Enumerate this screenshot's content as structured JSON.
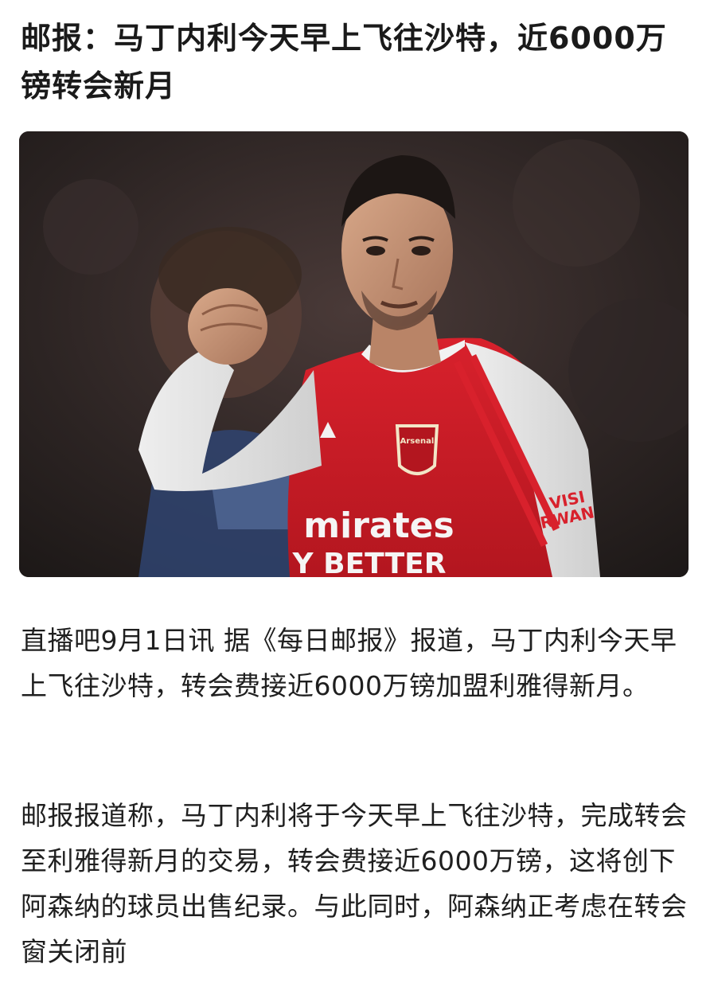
{
  "article": {
    "headline": "邮报：马丁内利今天早上飞往沙特，近6000万镑转会新月",
    "image": {
      "sponsor_line_1": "mirates",
      "sponsor_line_2": "Y BETTER",
      "sleeve_text_1": "VISI",
      "sleeve_text_2": "RWAN",
      "crest_text": "Arsenal"
    },
    "paragraphs": [
      "直播吧9月1日讯 据《每日邮报》报道，马丁内利今天早上飞往沙特，转会费接近6000万镑加盟利雅得新月。",
      "邮报报道称，马丁内利将于今天早上飞往沙特，完成转会至利雅得新月的交易，转会费接近6000万镑，这将创下阿森纳的球员出售纪录。与此同时，阿森纳正考虑在转会窗关闭前"
    ]
  }
}
